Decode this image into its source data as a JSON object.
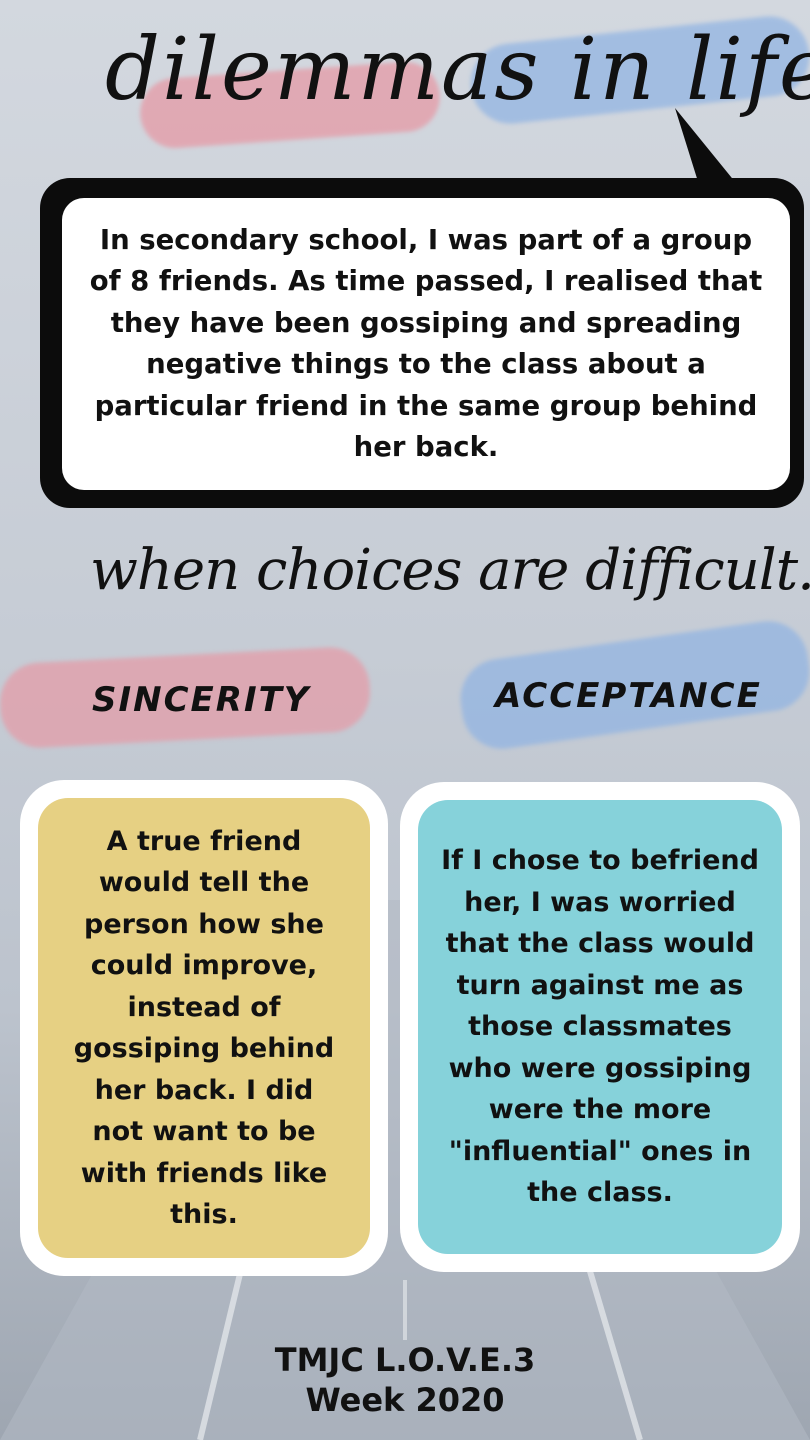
{
  "header": {
    "title": "dilemmas in life"
  },
  "story": {
    "text": "In secondary school, I was part of a group of 8 friends. As time passed, I realised that they have been gossiping and spreading negative things to the class about a particular friend in the same group behind her back."
  },
  "subtitle": "when choices are difficult...",
  "values": {
    "left_label": "SINCERITY",
    "right_label": "ACCEPTANCE"
  },
  "cards": {
    "left": {
      "text": "A true friend would tell the person how she could improve, instead of gossiping behind her back. I did not want to be with friends like this.",
      "color": "#e6d083"
    },
    "right": {
      "text": "If I chose to befriend her, I was worried that the class would turn against me as those classmates who were gossiping were the more \"influential\" ones in the class.",
      "color": "#86d2da"
    }
  },
  "footer": {
    "line1": "TMJC L.O.V.E.3",
    "line2": "Week 2020"
  },
  "colors": {
    "pink_stroke": "#e69aa6",
    "blue_stroke": "#8fb3e3"
  }
}
